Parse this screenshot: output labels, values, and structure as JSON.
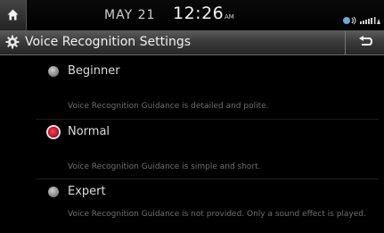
{
  "status": {
    "date": "MAY 21",
    "time": "12:26",
    "ampm": "AM",
    "icons": [
      "home-icon",
      "bluetooth-phone-icon",
      "signal-icon"
    ]
  },
  "header": {
    "title": "Voice Recognition Settings",
    "icon": "gear-icon",
    "back_icon": "back-arrow-icon"
  },
  "options": [
    {
      "label": "Beginner",
      "description": "Voice Recognition Guidance is detailed and polite.",
      "selected": false
    },
    {
      "label": "Normal",
      "description": "Voice Recognition Guidance is simple and short.",
      "selected": true
    },
    {
      "label": "Expert",
      "description": "Voice Recognition Guidance is not provided. Only a sound effect is played.",
      "selected": false
    }
  ],
  "colors": {
    "accent": "#c8102e",
    "background": "#000000"
  }
}
